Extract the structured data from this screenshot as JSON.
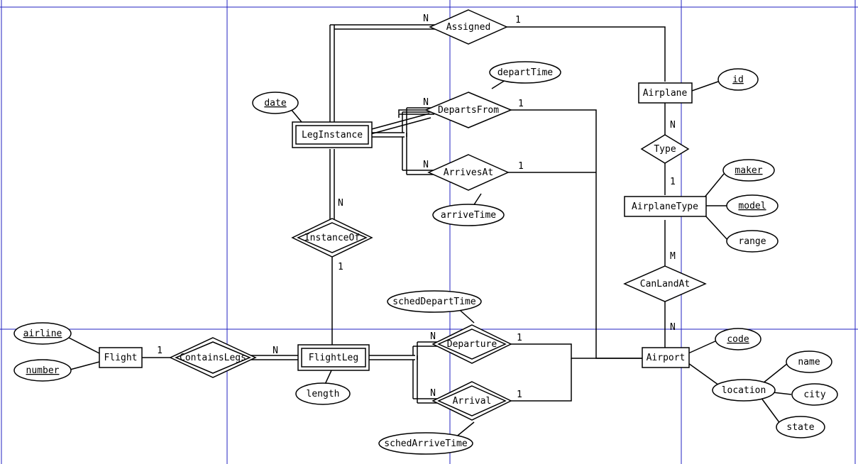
{
  "chart_data": {
    "type": "er-diagram",
    "entities": [
      {
        "name": "Flight",
        "weak": false,
        "attributes": [
          "airline",
          "number"
        ]
      },
      {
        "name": "FlightLeg",
        "weak": true,
        "attributes": [
          "length"
        ]
      },
      {
        "name": "LegInstance",
        "weak": true,
        "attributes": [
          "date"
        ]
      },
      {
        "name": "Airplane",
        "weak": false,
        "attributes": [
          "id"
        ]
      },
      {
        "name": "AirplaneType",
        "weak": false,
        "attributes": [
          "maker",
          "model",
          "range"
        ]
      },
      {
        "name": "Airport",
        "weak": false,
        "attributes": [
          "code",
          "location",
          "name",
          "city",
          "state"
        ]
      }
    ],
    "relationships": [
      {
        "name": "ContainsLegs",
        "identifying": true,
        "between": [
          "Flight",
          "FlightLeg"
        ],
        "card": [
          "1",
          "N"
        ]
      },
      {
        "name": "InstanceOf",
        "identifying": true,
        "between": [
          "FlightLeg",
          "LegInstance"
        ],
        "card": [
          "1",
          "N"
        ]
      },
      {
        "name": "Departure",
        "identifying": true,
        "between": [
          "FlightLeg",
          "Airport"
        ],
        "card": [
          "N",
          "1"
        ],
        "attributes": [
          "schedDepartTime"
        ]
      },
      {
        "name": "Arrival",
        "identifying": true,
        "between": [
          "FlightLeg",
          "Airport"
        ],
        "card": [
          "N",
          "1"
        ],
        "attributes": [
          "schedArriveTime"
        ]
      },
      {
        "name": "DepartsFrom",
        "identifying": false,
        "between": [
          "LegInstance",
          "Airport"
        ],
        "card": [
          "N",
          "1"
        ],
        "attributes": [
          "departTime"
        ]
      },
      {
        "name": "ArrivesAt",
        "identifying": false,
        "between": [
          "LegInstance",
          "Airport"
        ],
        "card": [
          "N",
          "1"
        ],
        "attributes": [
          "arriveTime"
        ]
      },
      {
        "name": "Assigned",
        "identifying": false,
        "between": [
          "LegInstance",
          "Airplane"
        ],
        "card": [
          "N",
          "1"
        ]
      },
      {
        "name": "Type",
        "identifying": false,
        "between": [
          "Airplane",
          "AirplaneType"
        ],
        "card": [
          "N",
          "1"
        ]
      },
      {
        "name": "CanLandAt",
        "identifying": false,
        "between": [
          "AirplaneType",
          "Airport"
        ],
        "card": [
          "M",
          "N"
        ]
      }
    ]
  },
  "labels": {
    "entities": {
      "Flight": "Flight",
      "FlightLeg": "FlightLeg",
      "LegInstance": "LegInstance",
      "Airplane": "Airplane",
      "AirplaneType": "AirplaneType",
      "Airport": "Airport"
    },
    "rels": {
      "ContainsLegs": "ContainsLegs",
      "InstanceOf": "InstanceOf",
      "Departure": "Departure",
      "Arrival": "Arrival",
      "DepartsFrom": "DepartsFrom",
      "ArrivesAt": "ArrivesAt",
      "Assigned": "Assigned",
      "Type": "Type",
      "CanLandAt": "CanLandAt"
    },
    "attrs": {
      "airline": "airline",
      "number": "number",
      "length": "length",
      "date": "date",
      "id": "id",
      "maker": "maker",
      "model": "model",
      "range": "range",
      "code": "code",
      "location": "location",
      "name": "name",
      "city": "city",
      "state": "state",
      "schedDepartTime": "schedDepartTime",
      "schedArriveTime": "schedArriveTime",
      "departTime": "departTime",
      "arriveTime": "arriveTime"
    },
    "card": {
      "1": "1",
      "N": "N",
      "M": "M"
    }
  }
}
